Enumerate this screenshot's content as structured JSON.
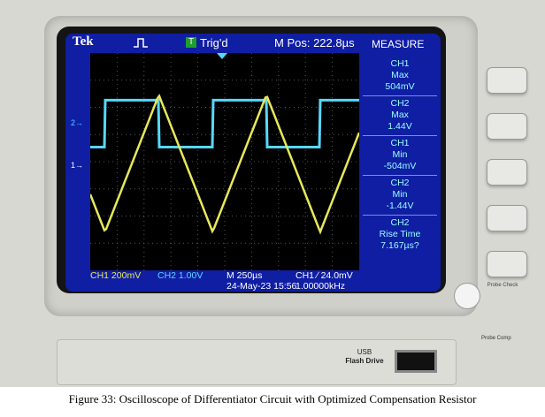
{
  "header": {
    "brand": "Tek",
    "trigger_badge": "T",
    "trigger_status": "Trig'd",
    "m_pos": "M Pos: 222.8µs",
    "measure_title": "MEASURE"
  },
  "measure_menu": [
    {
      "channel": "CH1",
      "name": "Max",
      "value": "504mV"
    },
    {
      "channel": "CH2",
      "name": "Max",
      "value": "1.44V"
    },
    {
      "channel": "CH1",
      "name": "Min",
      "value": "-504mV"
    },
    {
      "channel": "CH2",
      "name": "Min",
      "value": "-1.44V"
    },
    {
      "channel": "CH2",
      "name": "Rise Time",
      "value": "7.167µs?"
    }
  ],
  "footer": {
    "ch1_scale": "CH1  200mV",
    "ch2_scale": "CH2  1.00V",
    "timebase": "M 250µs",
    "trigger_info": "CH1 ∕ 24.0mV",
    "date": "24-May-23 15:56",
    "frequency": "1.00000kHz"
  },
  "markers": {
    "ch1": "1→",
    "ch2": "2→"
  },
  "panel": {
    "usb_label_1": "USB",
    "usb_label_2": "Flash Drive",
    "probe_check": "Probe Check",
    "probe_comp": "Probe Comp"
  },
  "caption": "Figure 33: Oscilloscope of Differentiator Circuit with Optimized Compensation Resistor",
  "colors": {
    "ch1": "#e8e85a",
    "ch2": "#57d8ff",
    "screen_bg": "#0f1ea3"
  }
}
